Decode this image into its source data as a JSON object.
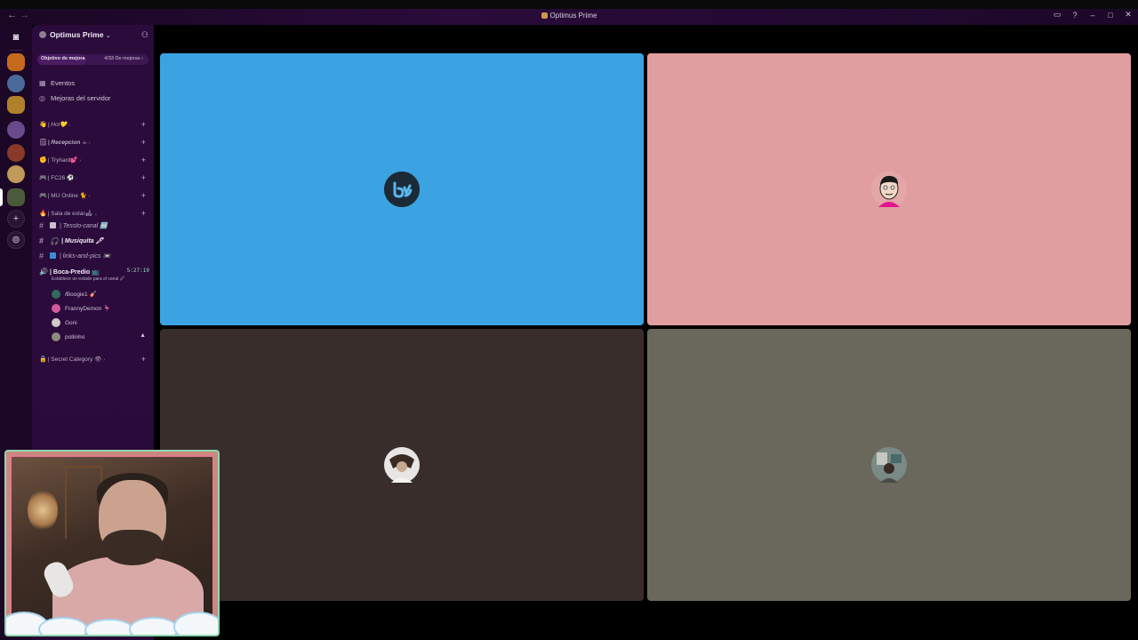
{
  "window": {
    "title": "Optimus Prime",
    "back_glyph": "←",
    "forward_glyph": "→",
    "icons": [
      "inbox-icon",
      "help-icon",
      "minimize-icon",
      "maximize-icon",
      "close-icon"
    ],
    "icon_glyphs": {
      "inbox": "▭",
      "help": "?",
      "minimize": "–",
      "maximize": "□",
      "close": "✕"
    }
  },
  "server": {
    "name": "Optimus Prime",
    "chevron": "⌄",
    "add_member_glyph": "⚇",
    "boost": {
      "goal_label": "Objetivo de mejora",
      "progress_label": "4/33 De mejoras",
      "progress_fraction": 0.12,
      "chevron": "›"
    },
    "nav": [
      {
        "label": "Eventos",
        "icon": "calendar-icon",
        "glyph": "▦"
      },
      {
        "label": "Mejoras del servidor",
        "icon": "boost-icon",
        "glyph": "◎"
      }
    ],
    "categories": [
      {
        "label": "| Hol💛",
        "emoji": "👋"
      },
      {
        "label": "| Recepcion ☕",
        "emoji": "🗒"
      },
      {
        "label": "| Tryhard💕",
        "emoji": "✊"
      },
      {
        "label": "| FC26 ⚽",
        "emoji": "🎮"
      },
      {
        "label": "| MU Online 🐈",
        "emoji": "🎮"
      },
      {
        "label": "| Sala de estar🛋",
        "emoji": "🔥"
      }
    ],
    "channels": [
      {
        "label": "| Tessto-canal 🆒",
        "emoji_color": "#c9c2cf",
        "bold": false
      },
      {
        "label": "| Musiquita 🖊",
        "emoji_color": "#d0d0d0",
        "bold": true
      },
      {
        "label": "| links-and-pics 📼",
        "emoji_color": "#3a8fd8",
        "bold": false
      }
    ],
    "voice_channel": {
      "label": "| Boca-Predio 📺",
      "timer": "5:27:19",
      "status": "Establece un estado para el canal 🖉",
      "members": [
        {
          "name": "/Boogie1 🎸",
          "avatar_color": "#2f6c5a"
        },
        {
          "name": "FrannyDemon 🦩",
          "avatar_color": "#d25a9a"
        },
        {
          "name": "Goni",
          "avatar_color": "#cfcac6"
        },
        {
          "name": "pollinho",
          "avatar_color": "#8a8a7a",
          "live": true
        }
      ]
    },
    "secret_category": {
      "label": "| Secret Category 👁",
      "emoji": "🔒"
    },
    "plus_glyph": "+",
    "cat_chevron": "›"
  },
  "rail": {
    "home_glyph": "◙",
    "add_glyph": "+",
    "discover_glyph": "⊚"
  },
  "video_tiles": [
    {
      "color": "#3ba3e1",
      "avatar": "bluesky-logo-avatar"
    },
    {
      "color": "#e19ea0",
      "avatar": "cartoon-face-avatar"
    },
    {
      "color": "#382d2b",
      "avatar": "photo-avatar-1"
    },
    {
      "color": "#6a685c",
      "avatar": "photo-avatar-2"
    }
  ]
}
